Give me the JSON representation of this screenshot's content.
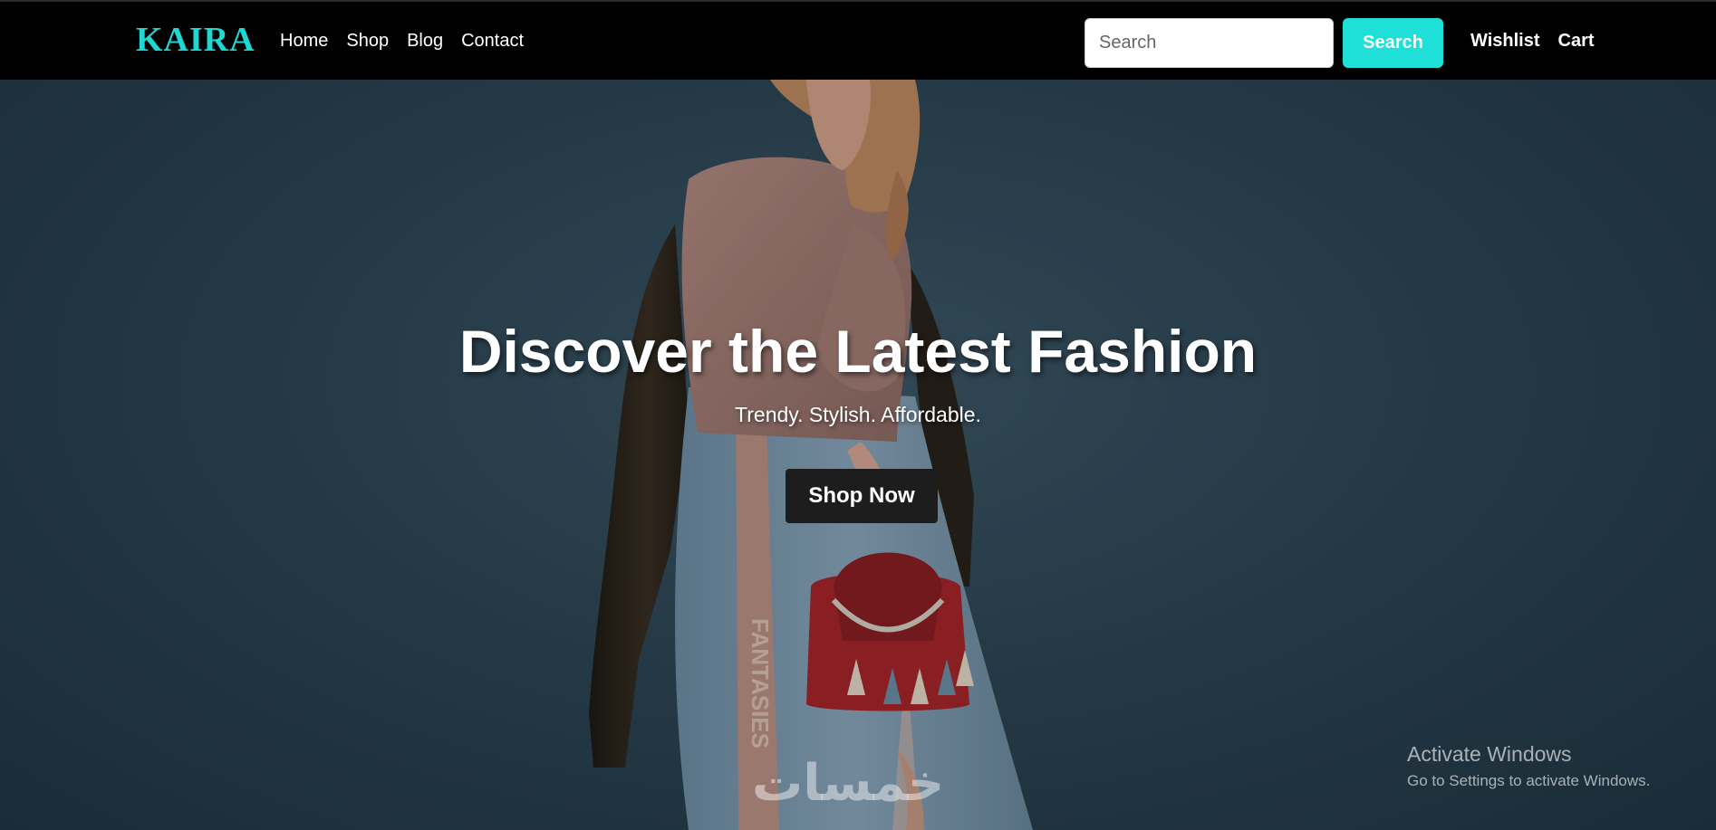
{
  "brand": {
    "name": "KAIRA"
  },
  "nav": {
    "links": [
      "Home",
      "Shop",
      "Blog",
      "Contact"
    ],
    "right_links": [
      "Wishlist",
      "Cart"
    ]
  },
  "search": {
    "placeholder": "Search",
    "value": "",
    "button_label": "Search"
  },
  "hero": {
    "title": "Discover the Latest Fashion",
    "subtitle": "Trendy. Stylish. Affordable.",
    "cta_label": "Shop Now",
    "image_text": "FANTASIES",
    "watermark": "خمسات"
  },
  "os_overlay": {
    "line1": "Activate Windows",
    "line2": "Go to Settings to activate Windows."
  },
  "colors": {
    "accent": "#1ee0d8",
    "navbar_bg": "#000000",
    "button_dark": "#1d1d1d",
    "hero_bg": "#2e4757"
  }
}
